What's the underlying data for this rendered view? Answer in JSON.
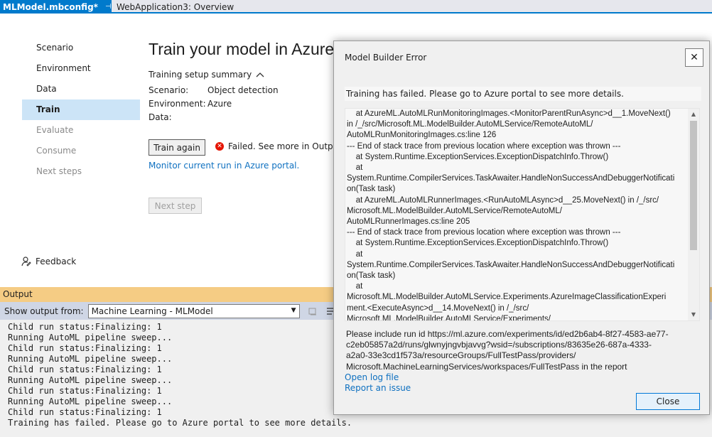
{
  "tabs": {
    "active": "MLModel.mbconfig*",
    "pin_glyph": "⊣",
    "close_glyph": "✕",
    "inactive": "WebApplication3: Overview"
  },
  "nav": {
    "items": [
      {
        "label": "Scenario"
      },
      {
        "label": "Environment"
      },
      {
        "label": "Data"
      },
      {
        "label": "Train"
      },
      {
        "label": "Evaluate"
      },
      {
        "label": "Consume"
      },
      {
        "label": "Next steps"
      }
    ],
    "feedback": "Feedback"
  },
  "main": {
    "title": "Train your model in Azure",
    "summary_label": "Training setup summary",
    "scenario_key": "Scenario:",
    "scenario_val": "Object detection",
    "environment_key": "Environment:",
    "environment_val": "Azure",
    "data_key": "Data:",
    "train_again": "Train again",
    "failed_text": "Failed. See more in Output Pane.",
    "monitor_link": "Monitor current run in Azure portal.",
    "next_step": "Next step"
  },
  "output": {
    "header": "Output",
    "show_from_label": "Show output from:",
    "source": "Machine Learning - MLModel",
    "lines": [
      "Child run status:Finalizing: 1",
      "Running AutoML pipeline sweep...",
      "Child run status:Finalizing: 1",
      "Running AutoML pipeline sweep...",
      "Child run status:Finalizing: 1",
      "Running AutoML pipeline sweep...",
      "Child run status:Finalizing: 1",
      "Running AutoML pipeline sweep...",
      "Child run status:Finalizing: 1",
      "Training has failed. Please go to Azure portal to see more details."
    ]
  },
  "dialog": {
    "title": "Model Builder Error",
    "message": "Training has failed. Please go to Azure portal to see more details.",
    "trace": [
      "    at AzureML.AutoMLRunMonitoringImages.<MonitorParentRunAsync>d__1.MoveNext()",
      "in /_/src/Microsoft.ML.ModelBuilder.AutoMLService/RemoteAutoML/",
      "AutoMLRunMonitoringImages.cs:line 126",
      "--- End of stack trace from previous location where exception was thrown ---",
      "    at System.Runtime.ExceptionServices.ExceptionDispatchInfo.Throw()",
      "    at",
      "System.Runtime.CompilerServices.TaskAwaiter.HandleNonSuccessAndDebuggerNotificati",
      "on(Task task)",
      "    at AzureML.AutoMLRunnerImages.<RunAutoMLAsync>d__25.MoveNext() in /_/src/",
      "Microsoft.ML.ModelBuilder.AutoMLService/RemoteAutoML/",
      "AutoMLRunnerImages.cs:line 205",
      "--- End of stack trace from previous location where exception was thrown ---",
      "    at System.Runtime.ExceptionServices.ExceptionDispatchInfo.Throw()",
      "    at",
      "System.Runtime.CompilerServices.TaskAwaiter.HandleNonSuccessAndDebuggerNotificati",
      "on(Task task)",
      "    at",
      "Microsoft.ML.ModelBuilder.AutoMLService.Experiments.AzureImageClassificationExperi",
      "ment.<ExecuteAsync>d__14.MoveNext() in /_/src/",
      "Microsoft.ML.ModelBuilder.AutoMLService/Experiments/"
    ],
    "run_info": [
      "Please include run id https://ml.azure.com/experiments/id/ed2b6ab4-8f27-4583-ae77-",
      "c2eb05857a2d/runs/glwnyjngvbjavvg?wsid=/subscriptions/83635e26-687a-4333-",
      "a2a0-33e3cd1f573a/resourceGroups/FullTestPass/providers/",
      "Microsoft.MachineLearningServices/workspaces/FullTestPass in the report"
    ],
    "open_log": "Open log file",
    "report_issue": "Report an issue",
    "close_button": "Close",
    "close_glyph": "✕"
  },
  "colors": {
    "accent": "#007acc",
    "nav_active": "#cce4f7",
    "output_header": "#f5cc84",
    "error": "#e51400",
    "link": "#0e70c0"
  }
}
